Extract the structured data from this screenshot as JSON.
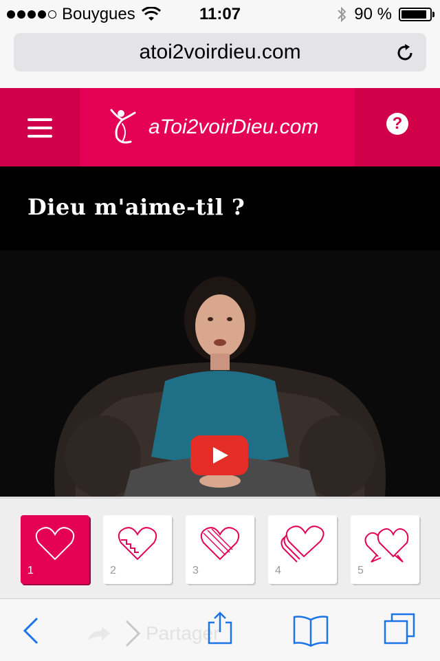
{
  "status": {
    "carrier": "Bouygues",
    "time": "11:07",
    "battery_text": "90 %",
    "battery_level": 0.9,
    "signal_bars": 4,
    "icons": [
      "signal-dots-icon",
      "wifi-icon",
      "bluetooth-icon",
      "battery-icon"
    ]
  },
  "browser": {
    "url": "atoi2voirdieu.com",
    "reload_icon": "reload-icon"
  },
  "header": {
    "menu_icon": "hamburger-menu-icon",
    "logo_text": "aToi2voirDieu.com",
    "help_label": "?",
    "brand_color": "#e40054"
  },
  "page": {
    "title": "Dieu m'aime-til ?"
  },
  "video": {
    "play_icon": "play-icon",
    "play_color": "#e52d27"
  },
  "steps": [
    {
      "number": "1",
      "icon": "heart-icon",
      "active": true
    },
    {
      "number": "2",
      "icon": "broken-heart-stairs-icon",
      "active": false
    },
    {
      "number": "3",
      "icon": "crossed-heart-icon",
      "active": false
    },
    {
      "number": "4",
      "icon": "stacked-hearts-icon",
      "active": false
    },
    {
      "number": "5",
      "icon": "two-speech-hearts-icon",
      "active": false
    }
  ],
  "toolbar": {
    "share_ghost_text": "Partager",
    "icons": [
      "back-icon",
      "forward-icon",
      "share-icon",
      "bookmarks-icon",
      "tabs-icon"
    ],
    "accent": "#1a73e8"
  }
}
